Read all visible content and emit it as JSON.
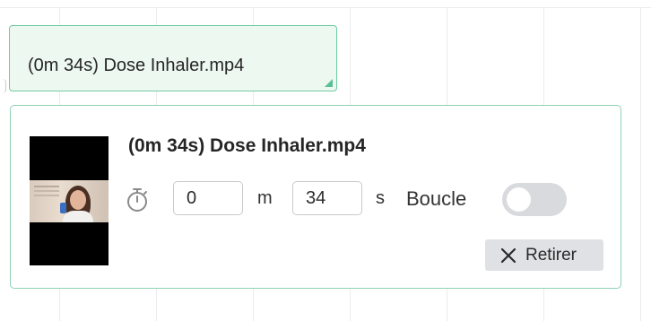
{
  "label_chip": {
    "text": "(0m 34s) Dose Inhaler.mp4"
  },
  "card": {
    "title": "(0m 34s) Dose Inhaler.mp4",
    "thumbnail_icon": "video-thumbnail",
    "timer_icon": "stopwatch-icon",
    "minutes_value": "0",
    "minutes_unit": "m",
    "seconds_value": "34",
    "seconds_unit": "s",
    "loop_label": "Boucle",
    "loop_enabled": false,
    "remove_icon": "close-icon",
    "remove_label": "Retirer"
  },
  "colors": {
    "accent_green": "#6fcba2",
    "chip_background": "#edf8f1",
    "toggle_off": "#d8dadd",
    "button_background": "#dfe1e4"
  }
}
